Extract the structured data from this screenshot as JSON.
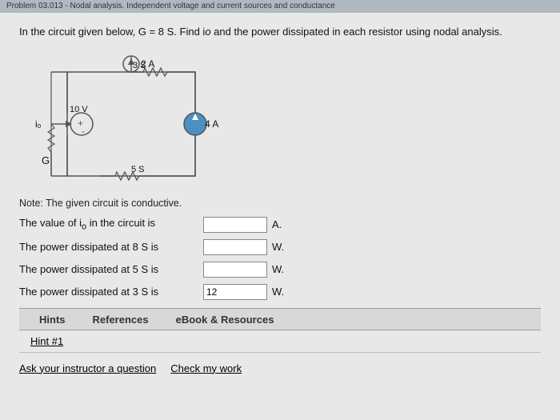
{
  "header": {
    "text": "Problem 03.013 - Nodal analysis. Independent voltage and current sources and conductance"
  },
  "problem": {
    "statement": "In the circuit given below, G = 8 S. Find i",
    "subscript": "o",
    "statement2": " and the power dissipated in each resistor using nodal analysis."
  },
  "circuit": {
    "current_source_top": "2 A",
    "voltage_source": "10 V",
    "resistor_3s": "3 S",
    "resistor_5s": "5 S",
    "current_source_right": "4 A",
    "conductance": "G",
    "current_label": "iₒ"
  },
  "note": {
    "text": "Note: The given circuit is conductive."
  },
  "questions": [
    {
      "label": "The value of iₒ in the circuit is",
      "input_value": "",
      "unit": "A."
    },
    {
      "label": "The power dissipated at 8 S is",
      "input_value": "",
      "unit": "W."
    },
    {
      "label": "The power dissipated at 5 S is",
      "input_value": "",
      "unit": "W."
    },
    {
      "label": "The power dissipated at 3 S is",
      "input_value": "12",
      "unit": "W."
    }
  ],
  "tabs": [
    {
      "label": "Hints",
      "active": false
    },
    {
      "label": "References",
      "active": false
    },
    {
      "label": "eBook & Resources",
      "active": false
    }
  ],
  "hint": {
    "text": "Hint #1"
  },
  "links": [
    {
      "label": "Ask your instructor a question"
    },
    {
      "label": "Check my work"
    }
  ]
}
